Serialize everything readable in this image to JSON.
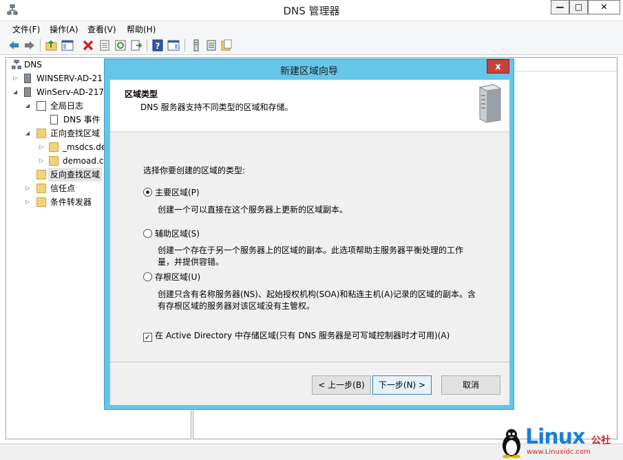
{
  "window": {
    "title": "DNS 管理器",
    "min_label": "—",
    "max_label": "□",
    "close_label": "✕"
  },
  "menu": [
    "文件(F)",
    "操作(A)",
    "查看(V)",
    "帮助(H)"
  ],
  "tree": {
    "root": "DNS",
    "server1": "WINSERV-AD-21",
    "server2": "WinServ-AD-217.",
    "global_logs": "全局日志",
    "dns_events": "DNS 事件",
    "forward_zones": "正向查找区域",
    "msdcs": "_msdcs.de",
    "demoad": "demoad.c",
    "reverse_zones": "反向查找区域",
    "trust_points": "信任点",
    "conditional_forwarders": "条件转发器"
  },
  "dialog": {
    "title": "新建区域向导",
    "close_label": "x",
    "header_title": "区域类型",
    "header_desc": "DNS 服务器支持不同类型的区域和存储。",
    "prompt": "选择你要创建的区域的类型:",
    "options": [
      {
        "label": "主要区域(P)",
        "desc": "创建一个可以直接在这个服务器上更新的区域副本。",
        "selected": true
      },
      {
        "label": "辅助区域(S)",
        "desc": "创建一个存在于另一个服务器上的区域的副本。此选项帮助主服务器平衡处理的工作量，并提供容错。",
        "selected": false
      },
      {
        "label": "存根区域(U)",
        "desc": "创建只含有名称服务器(NS)、起始授权机构(SOA)和粘连主机(A)记录的区域的副本。含有存根区域的服务器对该区域没有主管权。",
        "selected": false
      }
    ],
    "checkbox": {
      "label": "在 Active Directory 中存储区域(只有 DNS 服务器是可写域控制器时才可用)(A)",
      "checked": true,
      "mark": "✓"
    },
    "buttons": {
      "back": "< 上一步(B)",
      "next": "下一步(N) >",
      "cancel": "取消"
    }
  },
  "watermark": {
    "brand": "Linux",
    "brand_suffix": "公社",
    "url": "www.Linuxidc.com"
  }
}
